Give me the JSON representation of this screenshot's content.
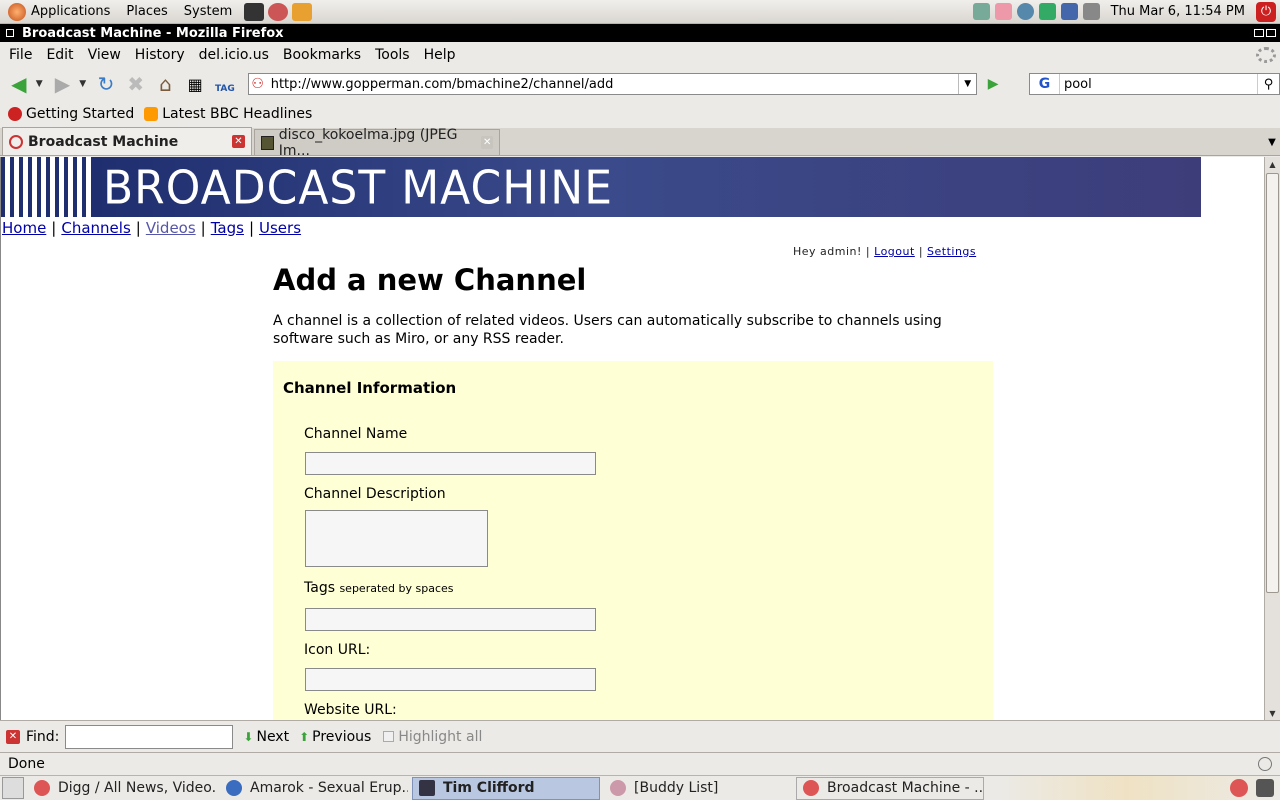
{
  "top_panel": {
    "menus": [
      "Applications",
      "Places",
      "System"
    ],
    "clock": "Thu Mar  6, 11:54 PM"
  },
  "window": {
    "title": "Broadcast Machine - Mozilla Firefox"
  },
  "menubar": {
    "items": [
      "File",
      "Edit",
      "View",
      "History",
      "del.icio.us",
      "Bookmarks",
      "Tools",
      "Help"
    ]
  },
  "navbar": {
    "url": "http://www.gopperman.com/bmachine2/channel/add",
    "search_value": "pool",
    "tag_label": "TAG"
  },
  "bookmarks": {
    "items": [
      "Getting Started",
      "Latest BBC Headlines"
    ]
  },
  "tabs": [
    {
      "label": "Broadcast Machine",
      "active": true
    },
    {
      "label": "disco_kokoelma.jpg (JPEG Im...",
      "active": false
    }
  ],
  "page": {
    "banner_text": "BROADCAST MACHINE",
    "nav": [
      "Home",
      "Channels",
      "Videos",
      "Tags",
      "Users"
    ],
    "nav_sep": "|",
    "greeting": "Hey admin!",
    "logout": "Logout",
    "settings": "Settings",
    "userbar_sep": "|",
    "heading": "Add a new Channel",
    "intro": "A channel is a collection of related videos. Users can automatically subscribe to channels using software such as Miro, or any RSS reader.",
    "form": {
      "section_title": "Channel Information",
      "channel_name_label": "Channel Name",
      "channel_name_value": "",
      "description_label": "Channel Description",
      "description_value": "",
      "tags_label": "Tags",
      "tags_hint": "seperated by spaces",
      "tags_value": "",
      "icon_url_label": "Icon URL:",
      "icon_url_value": "",
      "website_url_label": "Website URL:"
    }
  },
  "findbar": {
    "label": "Find:",
    "value": "",
    "next": "Next",
    "previous": "Previous",
    "highlight": "Highlight all"
  },
  "statusbar": {
    "text": "Done"
  },
  "taskbar": {
    "tasks": [
      {
        "label": "Digg / All News, Video...",
        "active": false
      },
      {
        "label": "Amarok - Sexual Erup...",
        "active": false
      },
      {
        "label": "Tim Clifford",
        "active": true
      },
      {
        "label": "[Buddy List]",
        "active": false
      },
      {
        "label": "Broadcast Machine - ...",
        "active": false
      }
    ]
  },
  "colors": {
    "form_bg": "#ffffd5",
    "banner_blue": "#2a3a7a",
    "link": "#0000aa"
  }
}
